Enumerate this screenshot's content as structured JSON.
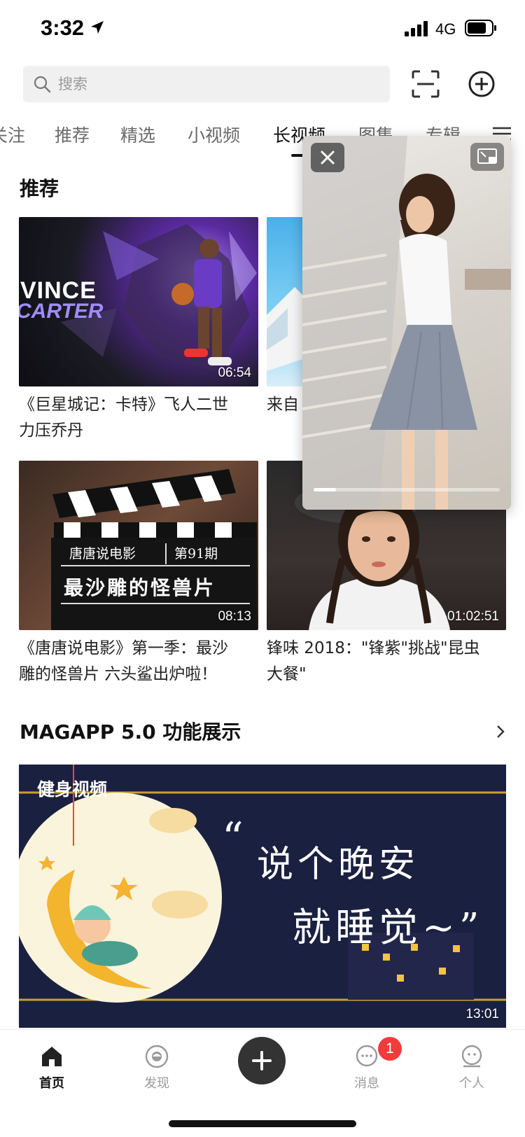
{
  "status_bar": {
    "time": "3:32",
    "network": "4G"
  },
  "search": {
    "placeholder": "搜索"
  },
  "tabs": [
    {
      "label": "关注"
    },
    {
      "label": "推荐"
    },
    {
      "label": "精选"
    },
    {
      "label": "小视频"
    },
    {
      "label": "长视频",
      "active": true
    },
    {
      "label": "图集"
    },
    {
      "label": "专辑"
    }
  ],
  "section1": {
    "title": "推荐",
    "cards": [
      {
        "title_line1": "《巨星城记：卡特》飞人二世",
        "title_line2": "力压乔丹",
        "duration": "06:54",
        "thumb_text1": "VINCE",
        "thumb_text2": "CARTER"
      },
      {
        "title_line1": "来自",
        "title_line2": "",
        "duration": ""
      },
      {
        "title_line1": "《唐唐说电影》第一季：最沙",
        "title_line2": "雕的怪兽片 六头鲨出炉啦！",
        "duration": "08:13",
        "thumb_text1": "唐唐说电影",
        "thumb_text2": "第91期",
        "thumb_text3": "最沙雕的怪兽片"
      },
      {
        "title_line1": "锋味 2018：\"锋紫\"挑战\"昆虫",
        "title_line2": "大餐\"",
        "duration": "01:02:51"
      }
    ]
  },
  "section2": {
    "title": "MAGAPP 5.0 功能展示",
    "banner": {
      "tag": "健身视频",
      "quote": "“",
      "line1": "说个晚安",
      "line2": "就睡觉~”",
      "duration": "13:01"
    }
  },
  "pip": {
    "progress": 0.12
  },
  "bottom_nav": {
    "items": [
      {
        "label": "首页",
        "active": true
      },
      {
        "label": "发现"
      },
      {
        "label": ""
      },
      {
        "label": "消息",
        "badge": "1"
      },
      {
        "label": "个人"
      }
    ]
  }
}
